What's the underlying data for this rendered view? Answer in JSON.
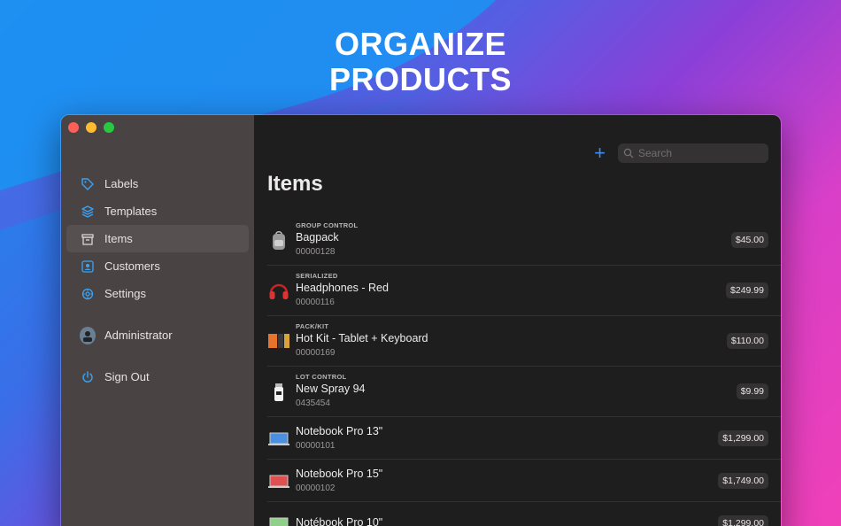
{
  "headline": {
    "line1": "ORGANIZE",
    "line2": "PRODUCTS"
  },
  "sidebar": {
    "items": [
      {
        "label": "Labels",
        "icon": "tag-icon"
      },
      {
        "label": "Templates",
        "icon": "layers-icon"
      },
      {
        "label": "Items",
        "icon": "archive-box-icon",
        "active": true
      },
      {
        "label": "Customers",
        "icon": "person-card-icon"
      },
      {
        "label": "Settings",
        "icon": "gear-icon"
      }
    ],
    "account": {
      "label": "Administrator",
      "icon": "avatar-icon"
    },
    "signout": {
      "label": "Sign Out",
      "icon": "power-icon"
    }
  },
  "toolbar": {
    "add_label": "+",
    "search_placeholder": "Search"
  },
  "main": {
    "title": "Items"
  },
  "items": [
    {
      "category": "GROUP CONTROL",
      "name": "Bagpack",
      "code": "00000128",
      "price": "$45.00",
      "icon": "backpack-icon"
    },
    {
      "category": "SERIALIZED",
      "name": "Headphones - Red",
      "code": "00000116",
      "price": "$249.99",
      "icon": "headphones-icon"
    },
    {
      "category": "PACK/KIT",
      "name": "Hot Kit - Tablet + Keyboard",
      "code": "00000169",
      "price": "$110.00",
      "icon": "tablet-kit-icon"
    },
    {
      "category": "LOT CONTROL",
      "name": "New Spray 94",
      "code": "0435454",
      "price": "$9.99",
      "icon": "spray-can-icon"
    },
    {
      "category": "",
      "name": "Notebook Pro 13\"",
      "code": "00000101",
      "price": "$1,299.00",
      "icon": "laptop-blue-icon"
    },
    {
      "category": "",
      "name": "Notebook Pro 15\"",
      "code": "00000102",
      "price": "$1,749.00",
      "icon": "laptop-red-icon"
    },
    {
      "category": "",
      "name": "Notébook Pro 10\"",
      "code": "",
      "price": "$1,299.00",
      "icon": "laptop-green-icon"
    }
  ],
  "colors": {
    "accent": "#3b8cf5",
    "sidebar": "#4a4343",
    "main": "#1f1e1e"
  }
}
